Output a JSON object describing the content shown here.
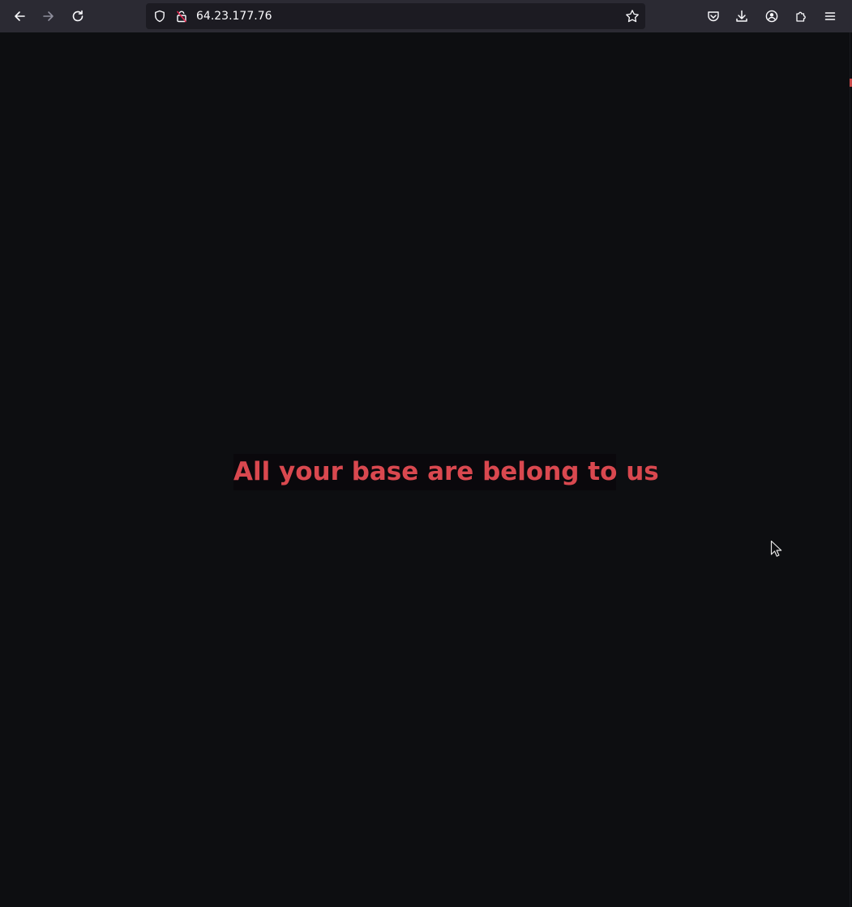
{
  "browser": {
    "url": "64.23.177.76",
    "icons": {
      "back": "back-arrow-icon",
      "forward": "forward-arrow-icon",
      "reload": "reload-icon",
      "tracking": "shield-icon",
      "security": "lock-warning-icon",
      "bookmark": "star-icon",
      "pocket": "pocket-icon",
      "downloads": "download-icon",
      "account": "account-icon",
      "extensions": "puzzle-icon",
      "menu": "hamburger-menu-icon"
    },
    "colors": {
      "toolbar": "#2b2a33",
      "urlbar": "#1c1b22",
      "icon": "#fbfbfe",
      "icon_disabled": "#8f8f9d"
    }
  },
  "page": {
    "headline": "All your base are belong to us",
    "colors": {
      "background": "#0d0e11",
      "headline_text": "#d9484f",
      "headline_background": "#0a080c"
    }
  }
}
